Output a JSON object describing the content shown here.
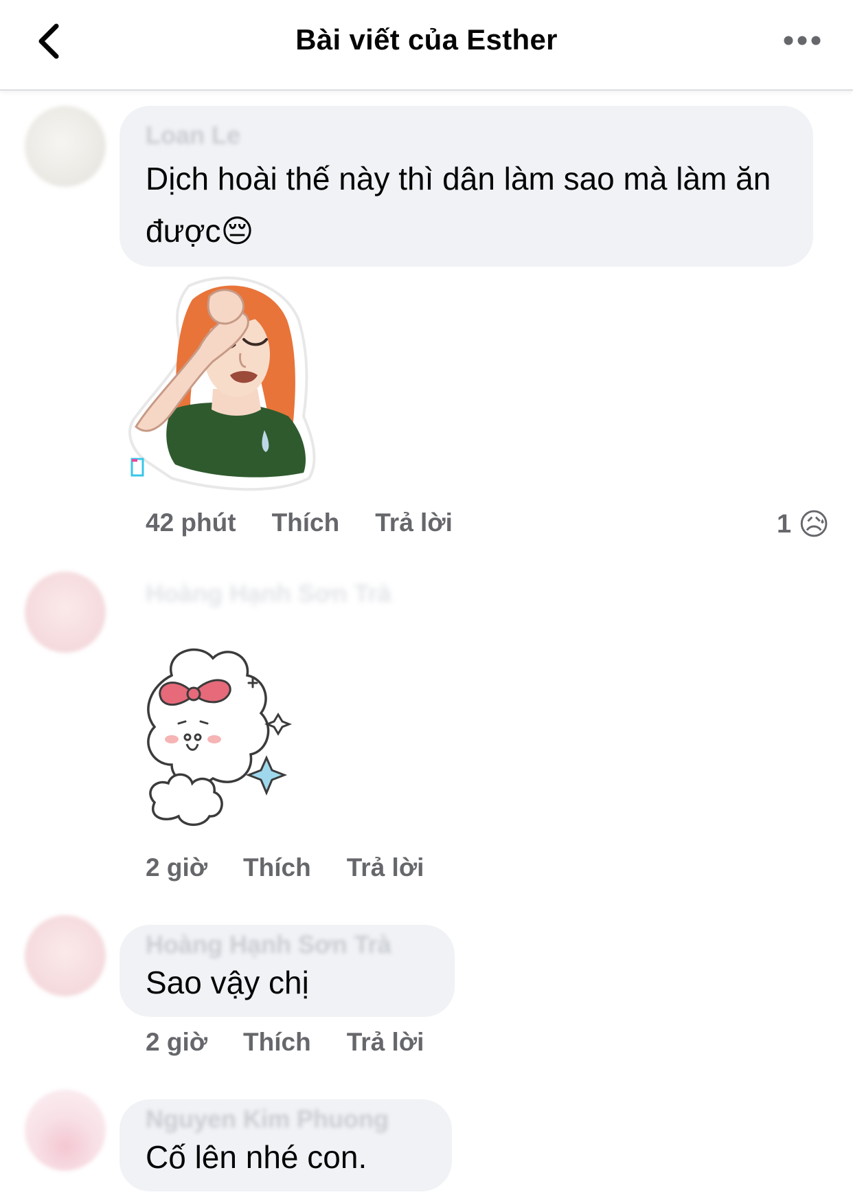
{
  "header": {
    "title": "Bài viết của Esther"
  },
  "comments": [
    {
      "author": "Loan Le",
      "text": "Dịch hoài thế này thì dân làm sao mà làm ăn được😔",
      "time": "42 phút",
      "like_label": "Thích",
      "reply_label": "Trả lời",
      "reaction_count": "1",
      "reaction_emoji": "😥"
    },
    {
      "author": "Hoàng Hạnh Sơn Trà",
      "time": "2 giờ",
      "like_label": "Thích",
      "reply_label": "Trả lời"
    },
    {
      "author": "Hoàng Hạnh Sơn Trà",
      "text": "Sao vậy chị",
      "time": "2 giờ",
      "like_label": "Thích",
      "reply_label": "Trả lời"
    },
    {
      "author": "Nguyen Kim Phuong",
      "text": "Cố lên nhé con."
    }
  ],
  "icons": {
    "back": "chevron-left-icon",
    "more": "more-horizontal-icon"
  }
}
